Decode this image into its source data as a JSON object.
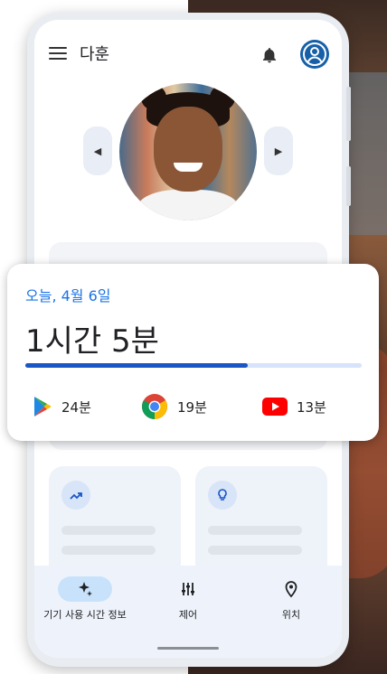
{
  "header": {
    "profile_name": "다훈"
  },
  "summary": {
    "date": "오늘, 4월 6일",
    "total_time": "1시간 5분",
    "progress_fraction": 0.66
  },
  "apps": [
    {
      "icon": "play-store-icon",
      "time": "24분"
    },
    {
      "icon": "chrome-icon",
      "time": "19분"
    },
    {
      "icon": "youtube-icon",
      "time": "13분"
    }
  ],
  "bottom_nav": [
    {
      "label": "기기 사용 시간 정보",
      "icon": "sparkle-icon",
      "active": true
    },
    {
      "label": "제어",
      "icon": "sliders-icon",
      "active": false
    },
    {
      "label": "위치",
      "icon": "location-pin-icon",
      "active": false
    }
  ],
  "colors": {
    "accent": "#1a73e8",
    "progress": "#1a56c4",
    "avatar": "#1760a8"
  }
}
